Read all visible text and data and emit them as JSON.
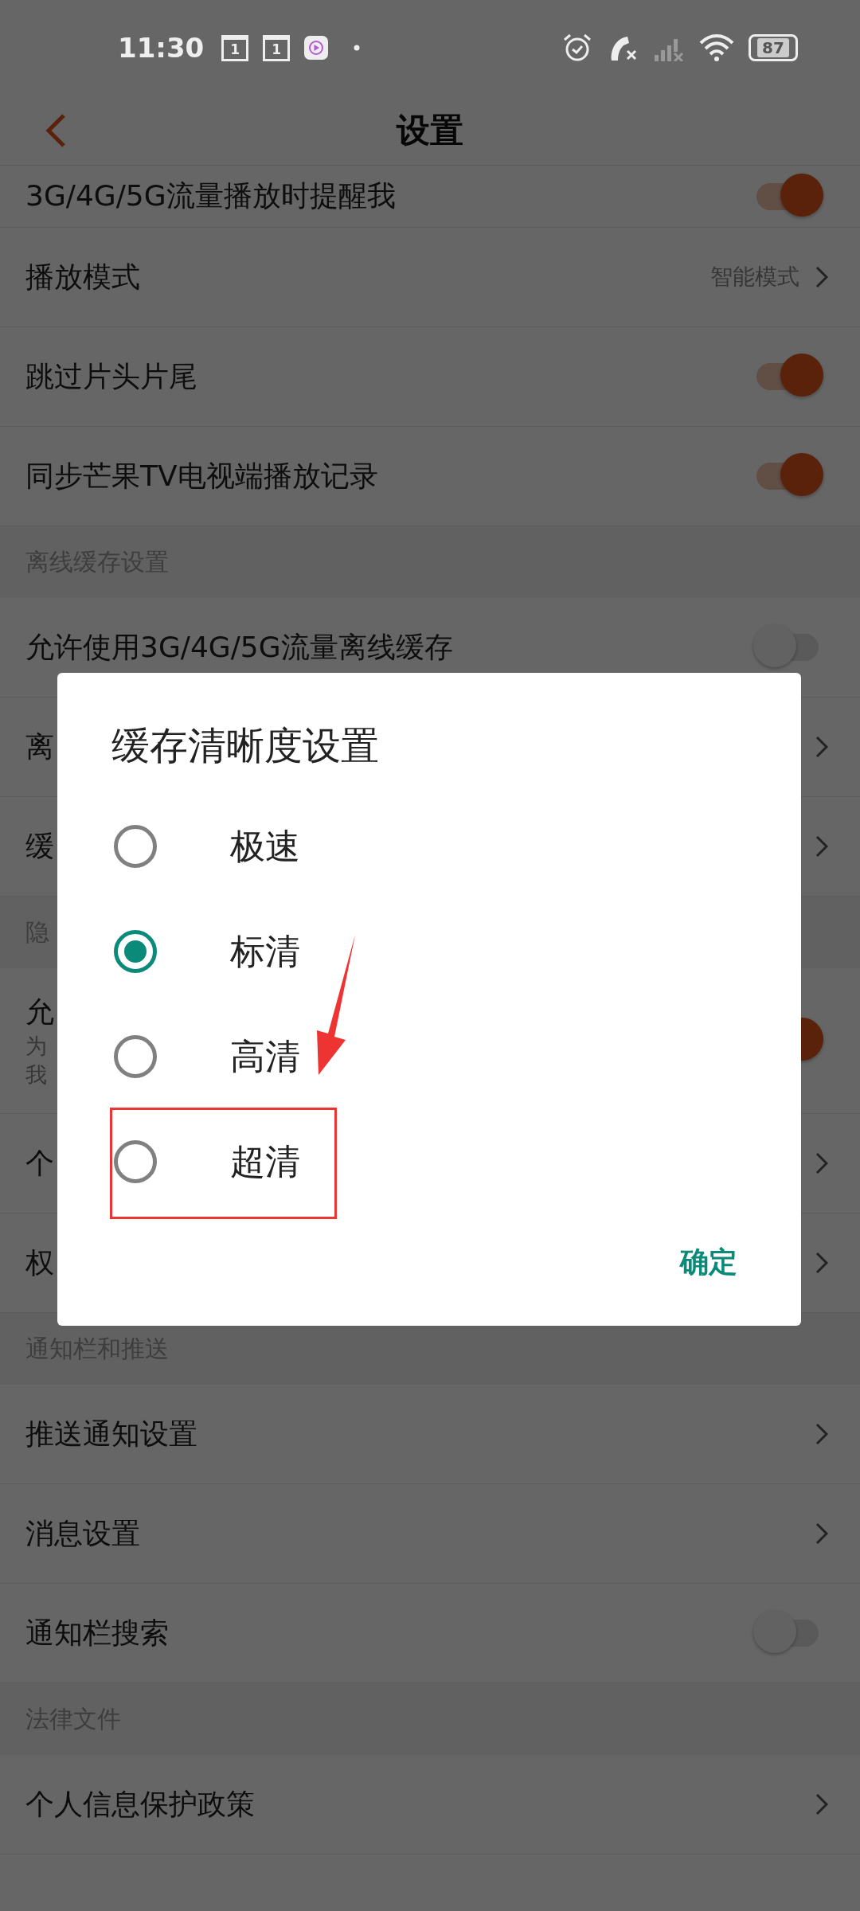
{
  "status_bar": {
    "time": "11:30",
    "notification_badges": [
      "1",
      "1"
    ],
    "battery": "87"
  },
  "header": {
    "title": "设置"
  },
  "settings": [
    {
      "kind": "toggle",
      "label": "3G/4G/5G流量播放时提醒我",
      "on": true
    },
    {
      "kind": "link",
      "label": "播放模式",
      "value": "智能模式"
    },
    {
      "kind": "toggle",
      "label": "跳过片头片尾",
      "on": true
    },
    {
      "kind": "toggle",
      "label": "同步芒果TV电视端播放记录",
      "on": true
    },
    {
      "kind": "section",
      "label": "离线缓存设置"
    },
    {
      "kind": "toggle",
      "label": "允许使用3G/4G/5G流量离线缓存",
      "on": false
    },
    {
      "kind": "link",
      "label": "离"
    },
    {
      "kind": "link",
      "label": "缓"
    },
    {
      "kind": "section",
      "label": "隐"
    },
    {
      "kind": "toggle",
      "label": "允",
      "description_lines": [
        "为",
        "我"
      ],
      "on": true
    },
    {
      "kind": "link",
      "label": "个"
    },
    {
      "kind": "link",
      "label": "权"
    },
    {
      "kind": "section",
      "label": "通知栏和推送"
    },
    {
      "kind": "link",
      "label": "推送通知设置"
    },
    {
      "kind": "link",
      "label": "消息设置"
    },
    {
      "kind": "toggle",
      "label": "通知栏搜索",
      "on": false
    },
    {
      "kind": "section",
      "label": "法律文件"
    },
    {
      "kind": "link",
      "label": "个人信息保护政策"
    }
  ],
  "dialog": {
    "title": "缓存清晰度设置",
    "options": [
      {
        "label": "极速",
        "selected": false,
        "highlighted": false
      },
      {
        "label": "标清",
        "selected": true,
        "highlighted": false
      },
      {
        "label": "高清",
        "selected": false,
        "highlighted": false
      },
      {
        "label": "超清",
        "selected": false,
        "highlighted": true
      }
    ],
    "confirm": "确定"
  }
}
